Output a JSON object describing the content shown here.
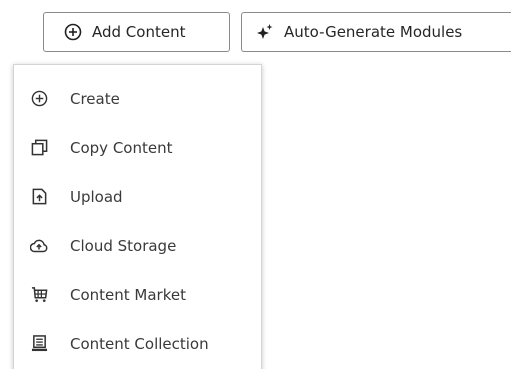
{
  "toolbar": {
    "add_content": {
      "label": "Add Content",
      "icon": "plus-circle-icon"
    },
    "auto_generate": {
      "label": "Auto-Generate Modules",
      "icon": "sparkle-icon"
    }
  },
  "menu": {
    "items": [
      {
        "label": "Create",
        "icon": "plus-circle-icon"
      },
      {
        "label": "Copy Content",
        "icon": "copy-icon"
      },
      {
        "label": "Upload",
        "icon": "upload-file-icon"
      },
      {
        "label": "Cloud Storage",
        "icon": "cloud-upload-icon"
      },
      {
        "label": "Content Market",
        "icon": "market-icon"
      },
      {
        "label": "Content Collection",
        "icon": "collection-icon"
      }
    ]
  },
  "colors": {
    "text": "#333333",
    "border": "#8a8a8a",
    "background": "#ffffff"
  }
}
